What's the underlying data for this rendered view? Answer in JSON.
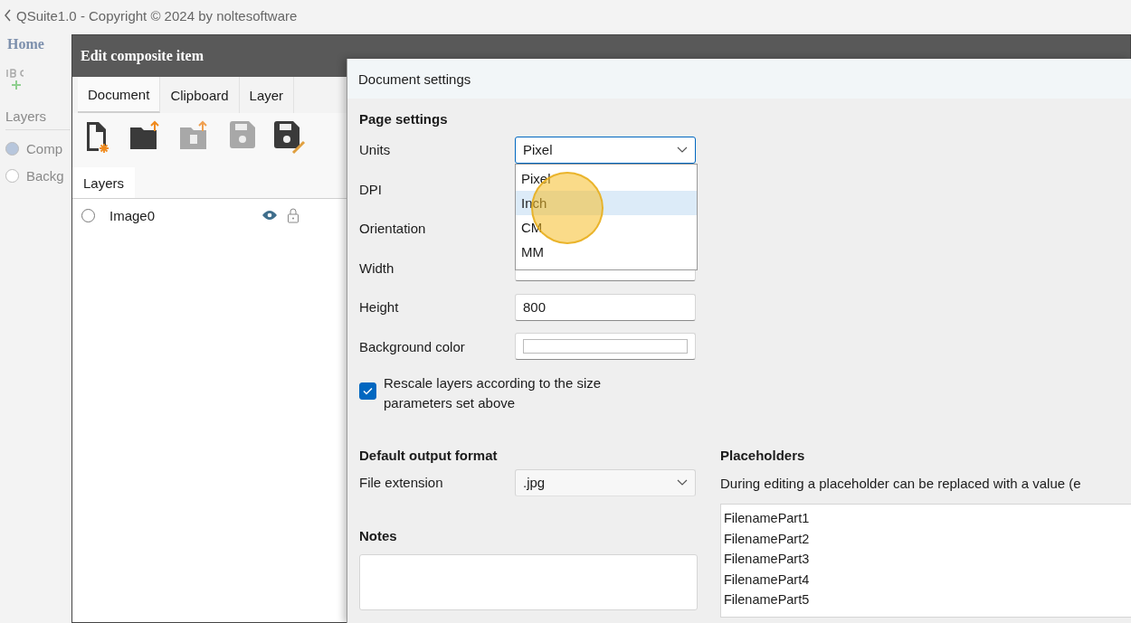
{
  "app": {
    "title": "QSuite1.0 - Copyright © 2024 by noltesoftware",
    "tab": "Home",
    "section": "Layers",
    "layers": [
      {
        "name": "Comp",
        "selected": true
      },
      {
        "name": "Backg",
        "selected": false
      }
    ]
  },
  "composite_dialog": {
    "title": "Edit composite item",
    "tabs": [
      {
        "label": "Document",
        "selected": true
      },
      {
        "label": "Clipboard",
        "selected": false
      },
      {
        "label": "Layer",
        "selected": false
      }
    ],
    "tools": [
      {
        "kind": "new",
        "disabled": false
      },
      {
        "kind": "open",
        "disabled": false
      },
      {
        "kind": "import",
        "disabled": true
      },
      {
        "kind": "save",
        "disabled": true
      },
      {
        "kind": "saveas",
        "disabled": false
      }
    ],
    "panel_tab": "Layers",
    "layers": [
      {
        "name": "Image0",
        "selected": false,
        "visible": true
      }
    ]
  },
  "settings": {
    "title": "Document settings",
    "page_heading": "Page settings",
    "fields": [
      {
        "label": "Units",
        "kind": "select",
        "value": "Pixel",
        "expanded": true,
        "options": [
          {
            "label": "Pixel",
            "highlighted": false
          },
          {
            "label": "Inch",
            "highlighted": true
          },
          {
            "label": "CM",
            "highlighted": false
          },
          {
            "label": "MM",
            "highlighted": false
          }
        ]
      },
      {
        "label": "DPI",
        "kind": "text"
      },
      {
        "label": "Orientation",
        "kind": "text"
      },
      {
        "label": "Width",
        "kind": "text"
      },
      {
        "label": "Height",
        "kind": "text",
        "value": "800"
      },
      {
        "label": "Background color",
        "kind": "color"
      }
    ],
    "rescale": {
      "label": "Rescale layers according to the size parameters set above",
      "checked": true
    },
    "output": {
      "heading": "Default output format",
      "label": "File extension",
      "value": ".jpg"
    },
    "notes": {
      "heading": "Notes"
    },
    "placeholders": {
      "heading": "Placeholders",
      "description": "During editing a placeholder can be replaced with a value (e",
      "items": [
        "FilenamePart1",
        "FilenamePart2",
        "FilenamePart3",
        "FilenamePart4",
        "FilenamePart5"
      ]
    }
  }
}
